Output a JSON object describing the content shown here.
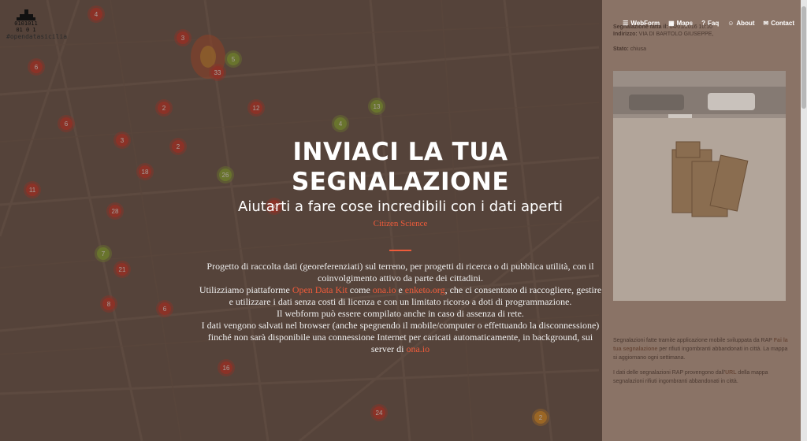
{
  "logo": {
    "glyph_top": "0101011",
    "glyph_bottom": "01 0 1",
    "hashtag": "#opendatasicilia"
  },
  "nav": [
    {
      "label": "WebForm",
      "icon": "list-icon"
    },
    {
      "label": "Maps",
      "icon": "map-icon"
    },
    {
      "label": "Faq",
      "icon": "question-icon"
    },
    {
      "label": "About",
      "icon": "users-icon"
    },
    {
      "label": "Contact",
      "icon": "envelope-icon"
    }
  ],
  "hero": {
    "title": "INVIACI LA TUA SEGNALAZIONE",
    "subtitle": "Aiutarti a fare cose incredibili con i dati aperti",
    "kicker": "Citizen Science",
    "p1": "Progetto di raccolta dati (georeferenziati) sul terreno, per progetti di ricerca o di pubblica utilità, con il coinvolgimento attivo da parte dei cittadini.",
    "p2a": "Utilizziamo piattaforme ",
    "link_odk": "Open Data Kit",
    "p2b": " come ",
    "link_ona": "ona.io",
    "p2c": " e ",
    "link_enketo": "enketo.org",
    "p2d": ", che ci consentono di raccogliere, gestire e utilizzare i dati senza costi di licenza e con un limitato ricorso a doti di programmazione.",
    "p3": "Il webform può essere compilato anche in caso di assenza di rete.",
    "p4": "I dati vengono salvati nel browser (anche spegnendo il mobile/computer o effettuando la disconnessione) finché non sarà disponibile una connessione Internet per caricati automaticamente, in background, sui server di ",
    "link_ona2": "ona.io"
  },
  "side": {
    "line1_label": "Segnalazione fatta il:",
    "line1_value": "04/01/2016 10:10",
    "line2_label": "Indirizzo:",
    "line2_value": "VIA DI BARTOLO GIUSEPPE,",
    "line3_label": "Stato:",
    "line3_value": "chiusa",
    "info1": "Segnalazioni fatte tramite applicazione mobile sviluppata da RAP",
    "info1_link": "Fai la tua segnalazione",
    "info1_rest": " per rifiuti ingombranti abbandonati in città. La mappa si aggiornano ogni settimana.",
    "info2a": "I dati delle segnalazioni RAP provengono dall'",
    "info2_link": "URL",
    "info2b": " della mappa segnalazioni rifiuti ingombranti abbandonati in città."
  },
  "map_markers": [
    {
      "n": "4",
      "c": "red"
    },
    {
      "n": "3",
      "c": "red"
    },
    {
      "n": "6",
      "c": "red"
    },
    {
      "n": "5",
      "c": "green"
    },
    {
      "n": "33",
      "c": "red"
    },
    {
      "n": "2",
      "c": "red"
    },
    {
      "n": "4",
      "c": "green"
    },
    {
      "n": "12",
      "c": "red"
    },
    {
      "n": "6",
      "c": "red"
    },
    {
      "n": "3",
      "c": "red"
    },
    {
      "n": "2",
      "c": "red"
    },
    {
      "n": "18",
      "c": "red"
    },
    {
      "n": "40",
      "c": "red"
    },
    {
      "n": "11",
      "c": "red"
    },
    {
      "n": "28",
      "c": "red"
    },
    {
      "n": "21",
      "c": "red"
    },
    {
      "n": "16",
      "c": "red"
    },
    {
      "n": "24",
      "c": "red"
    },
    {
      "n": "2",
      "c": "orange"
    },
    {
      "n": "8",
      "c": "red"
    },
    {
      "n": "6",
      "c": "red"
    },
    {
      "n": "26",
      "c": "green"
    },
    {
      "n": "13",
      "c": "green"
    },
    {
      "n": "7",
      "c": "green"
    }
  ],
  "colors": {
    "accent": "#ef5b3a",
    "marker_red": "#cc3b2e",
    "marker_green": "#8fb33a",
    "marker_orange": "#e89a2a"
  }
}
